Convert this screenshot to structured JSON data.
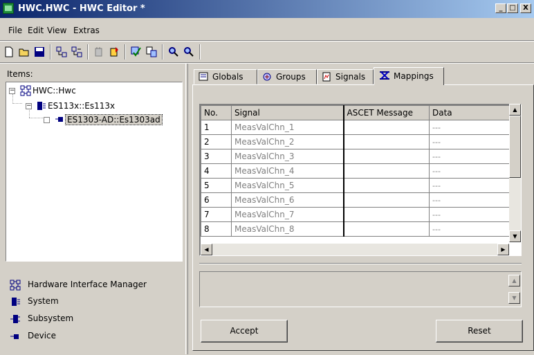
{
  "window": {
    "title": "HWC.HWC - HWC Editor  *",
    "controls": {
      "minimize": "_",
      "maximize": "□",
      "close": "X"
    }
  },
  "menu": [
    "File",
    "Edit",
    "View",
    "Extras"
  ],
  "toolbar_icons": [
    "new-icon",
    "open-icon",
    "save-icon",
    "add-system-icon",
    "add-subsystem-icon",
    "add-device-icon",
    "import-icon",
    "check-icon",
    "generate-icon",
    "search-icon",
    "search-next-icon"
  ],
  "left_panel": {
    "label": "Items:",
    "tree": [
      {
        "label": "HWC::Hwc",
        "level": 0,
        "expanded": true
      },
      {
        "label": "ES113x::Es113x",
        "level": 1,
        "expanded": true
      },
      {
        "label": "ES1303-AD::Es1303ad",
        "level": 2,
        "expanded": false,
        "selected": true
      }
    ],
    "legend": [
      {
        "icon": "hardware-interface-manager-icon",
        "label": "Hardware Interface Manager"
      },
      {
        "icon": "system-icon",
        "label": "System"
      },
      {
        "icon": "subsystem-icon",
        "label": "Subsystem"
      },
      {
        "icon": "device-icon",
        "label": "Device"
      }
    ]
  },
  "tabs": [
    {
      "label": "Globals",
      "active": false
    },
    {
      "label": "Groups",
      "active": false
    },
    {
      "label": "Signals",
      "active": false
    },
    {
      "label": "Mappings",
      "active": true
    }
  ],
  "table": {
    "columns": [
      "No.",
      "Signal",
      "ASCET Message",
      "Data"
    ],
    "rows": [
      {
        "no": "1",
        "signal": "MeasValChn_1",
        "message": "",
        "data": "---"
      },
      {
        "no": "2",
        "signal": "MeasValChn_2",
        "message": "",
        "data": "---"
      },
      {
        "no": "3",
        "signal": "MeasValChn_3",
        "message": "",
        "data": "---"
      },
      {
        "no": "4",
        "signal": "MeasValChn_4",
        "message": "",
        "data": "---"
      },
      {
        "no": "5",
        "signal": "MeasValChn_5",
        "message": "",
        "data": "---"
      },
      {
        "no": "6",
        "signal": "MeasValChn_6",
        "message": "",
        "data": "---"
      },
      {
        "no": "7",
        "signal": "MeasValChn_7",
        "message": "",
        "data": "---"
      },
      {
        "no": "8",
        "signal": "MeasValChn_8",
        "message": "",
        "data": "---"
      }
    ]
  },
  "buttons": {
    "accept": "Accept",
    "reset": "Reset"
  },
  "colors": {
    "title_start": "#0a246a",
    "title_end": "#a6caf0",
    "face": "#d4d0c8",
    "disabled_text": "#808080"
  }
}
